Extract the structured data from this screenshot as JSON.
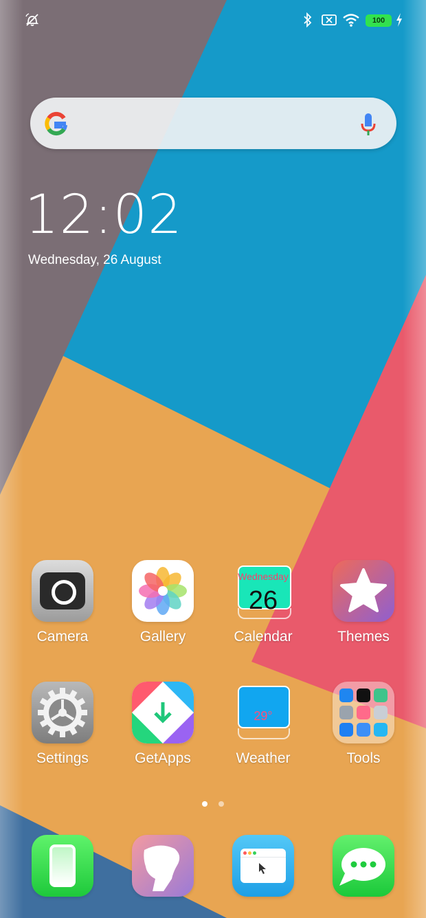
{
  "status_bar": {
    "icons": [
      "alarm-off-icon",
      "bluetooth-icon",
      "no-sim-icon",
      "wifi-icon",
      "battery-icon",
      "charging-bolt-icon"
    ],
    "battery_level": "100",
    "battery_color": "#33e04f"
  },
  "search": {
    "logo": "google-g-icon",
    "mic": "mic-icon"
  },
  "clock": {
    "time": "12:02",
    "date": "Wednesday, 26 August"
  },
  "apps": [
    {
      "label": "Camera",
      "icon": "camera-icon"
    },
    {
      "label": "Gallery",
      "icon": "gallery-flower-icon"
    },
    {
      "label": "Calendar",
      "icon": "calendar-icon",
      "weekday": "Wednesday",
      "day": "26"
    },
    {
      "label": "Themes",
      "icon": "star-icon"
    },
    {
      "label": "Settings",
      "icon": "gear-icon"
    },
    {
      "label": "GetApps",
      "icon": "getapps-icon"
    },
    {
      "label": "Weather",
      "icon": "weather-icon",
      "temp": "29°"
    },
    {
      "label": "Tools",
      "icon": "folder-icon"
    }
  ],
  "page_indicator": {
    "pages": 2,
    "active": 1
  },
  "dock": [
    {
      "icon": "phone-icon"
    },
    {
      "icon": "contacts-icon"
    },
    {
      "icon": "browser-icon"
    },
    {
      "icon": "messages-icon"
    }
  ],
  "colors": {
    "wall_blue": "#159ac9",
    "wall_orange": "#e8a552",
    "wall_red": "#e95a6b",
    "wall_grey": "#7b6e75"
  }
}
